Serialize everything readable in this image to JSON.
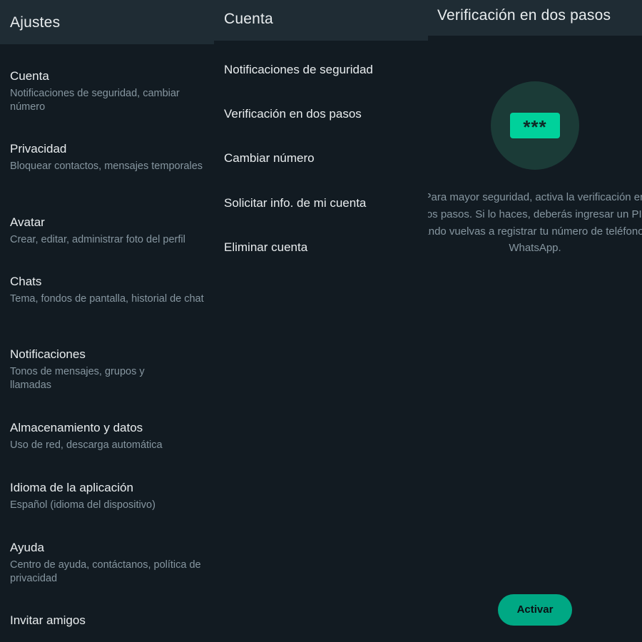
{
  "ajustes": {
    "title": "Ajustes",
    "items": [
      {
        "title": "Cuenta",
        "sub": "Notificaciones de seguridad, cambiar número"
      },
      {
        "title": "Privacidad",
        "sub": "Bloquear contactos, mensajes temporales"
      },
      {
        "title": "Avatar",
        "sub": "Crear, editar, administrar foto del perfil"
      },
      {
        "title": "Chats",
        "sub": "Tema, fondos de pantalla, historial de chat"
      },
      {
        "title": "Notificaciones",
        "sub": "Tonos de mensajes, grupos y llamadas"
      },
      {
        "title": "Almacenamiento y datos",
        "sub": "Uso de red, descarga automática"
      },
      {
        "title": "Idioma de la aplicación",
        "sub": "Español (idioma del dispositivo)"
      },
      {
        "title": "Ayuda",
        "sub": "Centro de ayuda, contáctanos, política de privacidad"
      },
      {
        "title": "Invitar amigos",
        "sub": ""
      }
    ]
  },
  "cuenta": {
    "title": "Cuenta",
    "items": [
      "Notificaciones de seguridad",
      "Verificación en dos pasos",
      "Cambiar número",
      "Solicitar info. de mi cuenta",
      "Eliminar cuenta"
    ]
  },
  "verificacion": {
    "title": "Verificación en dos pasos",
    "pin_icon_text": "***",
    "description_lines": [
      "Para mayor seguridad, activa la verificación en",
      "dos pasos. Si lo haces, deberás ingresar un PIN",
      "cuando vuelvas a registrar tu número de teléfono en",
      "WhatsApp."
    ],
    "button": "Activar"
  },
  "colors": {
    "background": "#121b22",
    "appbar": "#1f2c34",
    "primary_text": "#e9edef",
    "secondary_text": "#8696a0",
    "accent": "#00a884",
    "pin_green": "#00d19b",
    "icon_circle": "#1b3b37"
  }
}
